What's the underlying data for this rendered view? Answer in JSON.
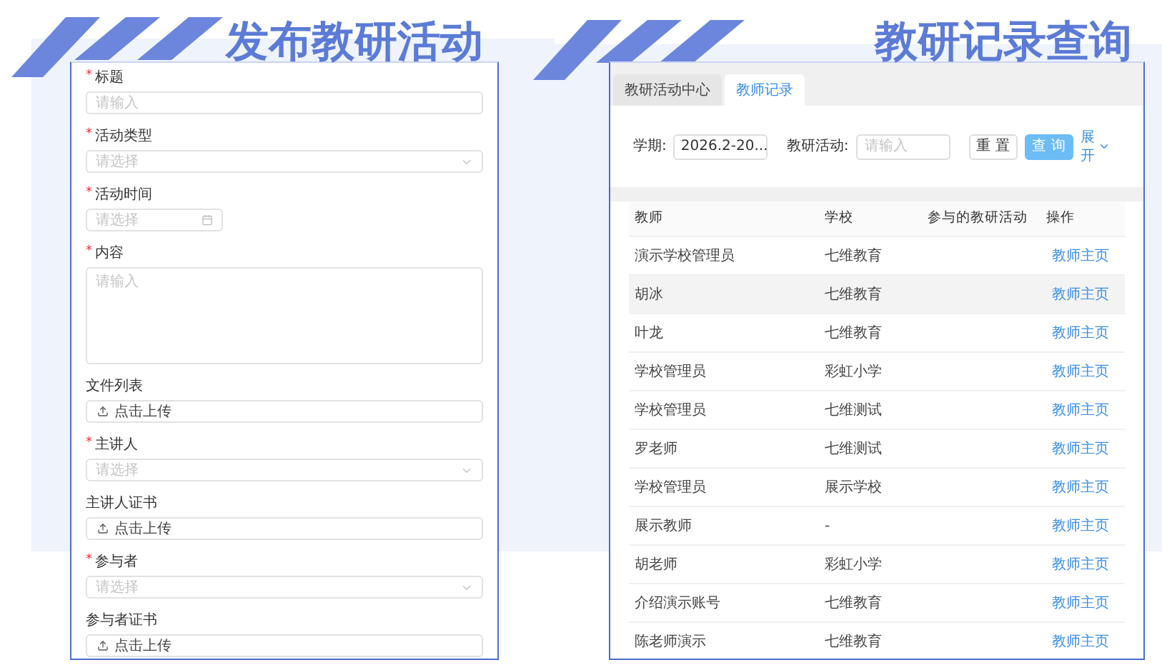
{
  "publish": {
    "title": "发布教研活动",
    "fields": [
      {
        "kind": "input",
        "required_mark": "*",
        "label": "标题",
        "placeholder": "请输入"
      },
      {
        "kind": "select",
        "required_mark": "*",
        "label": "活动类型",
        "placeholder": "请选择"
      },
      {
        "kind": "date",
        "required_mark": "*",
        "label": "活动时间",
        "placeholder": "请选择"
      },
      {
        "kind": "textarea",
        "required_mark": "*",
        "label": "内容",
        "placeholder": "请输入"
      },
      {
        "kind": "upload",
        "label": "文件列表",
        "button": "点击上传"
      },
      {
        "kind": "select",
        "required_mark": "*",
        "label": "主讲人",
        "placeholder": "请选择"
      },
      {
        "kind": "upload",
        "label": "主讲人证书",
        "button": "点击上传"
      },
      {
        "kind": "select",
        "required_mark": "*",
        "label": "参与者",
        "placeholder": "请选择"
      },
      {
        "kind": "upload",
        "label": "参与者证书",
        "button": "点击上传"
      }
    ]
  },
  "records": {
    "title": "教研记录查询",
    "tabs": [
      {
        "label": "教研活动中心",
        "selected": false
      },
      {
        "label": "教师记录",
        "selected": true
      }
    ],
    "filters": {
      "term_label": "学期:",
      "term_value": "2026.2-20...",
      "activity_label": "教研活动:",
      "activity_placeholder": "请输入"
    },
    "buttons": {
      "reset": "重 置",
      "search": "查 询"
    },
    "expand": "展开",
    "table": {
      "columns": [
        "教师",
        "学校",
        "参与的教研活动",
        "操作"
      ],
      "rows": [
        {
          "teacher": "演示学校管理员",
          "school": "七维教育",
          "action": "教师主页",
          "highlighted": false
        },
        {
          "teacher": "胡冰",
          "school": "七维教育",
          "action": "教师主页",
          "highlighted": true
        },
        {
          "teacher": "叶龙",
          "school": "七维教育",
          "action": "教师主页",
          "highlighted": false
        },
        {
          "teacher": "学校管理员",
          "school": "彩虹小学",
          "action": "教师主页",
          "highlighted": false
        },
        {
          "teacher": "学校管理员",
          "school": "七维测试",
          "action": "教师主页",
          "highlighted": false
        },
        {
          "teacher": "罗老师",
          "school": "七维测试",
          "action": "教师主页",
          "highlighted": false
        },
        {
          "teacher": "学校管理员",
          "school": "展示学校",
          "action": "教师主页",
          "highlighted": false
        },
        {
          "teacher": "展示教师",
          "school": "-",
          "action": "教师主页",
          "highlighted": false
        },
        {
          "teacher": "胡老师",
          "school": "彩虹小学",
          "action": "教师主页",
          "highlighted": false
        },
        {
          "teacher": "介绍演示账号",
          "school": "七维教育",
          "action": "教师主页",
          "highlighted": false
        },
        {
          "teacher": "陈老师演示",
          "school": "七维教育",
          "action": "教师主页",
          "highlighted": false
        }
      ]
    }
  }
}
